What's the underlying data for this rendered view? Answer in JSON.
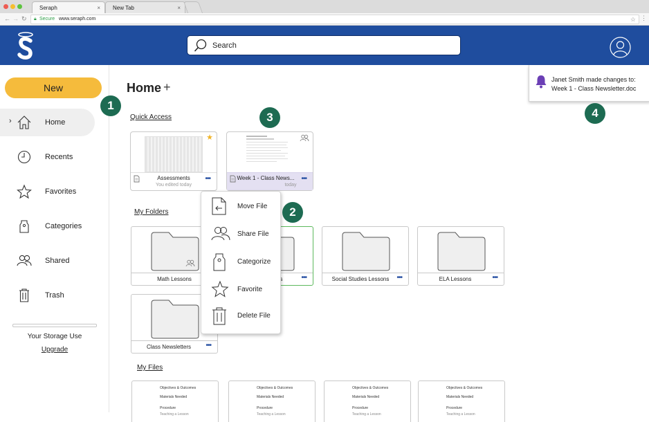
{
  "browser": {
    "tabs": [
      {
        "label": "Seraph",
        "close": "×"
      },
      {
        "label": "New Tab",
        "close": "×"
      }
    ],
    "secure_label": "Secure",
    "url": "www.seraph.com"
  },
  "header": {
    "logo_letter": "S",
    "search_placeholder": "Search"
  },
  "sidebar": {
    "new_label": "New",
    "items": [
      {
        "label": "Home",
        "icon": "home-icon",
        "active": true
      },
      {
        "label": "Recents",
        "icon": "clock-icon"
      },
      {
        "label": "Favorites",
        "icon": "star-icon"
      },
      {
        "label": "Categories",
        "icon": "tag-icon"
      },
      {
        "label": "Shared",
        "icon": "users-icon"
      },
      {
        "label": "Trash",
        "icon": "trash-icon"
      }
    ],
    "storage_label": "Your Storage Use",
    "upgrade_label": "Upgrade"
  },
  "main": {
    "title": "Home",
    "add_glyph": "+",
    "quick_access_label": "Quick Access",
    "quick_access": [
      {
        "name": "Assessments",
        "sub": "You edited today",
        "starred": true
      },
      {
        "name": "Week 1 - Class News...",
        "sub": "today",
        "shared": true,
        "selected": true
      }
    ],
    "my_folders_label": "My Folders",
    "folders": [
      {
        "name": "Math Lessons",
        "shared": true
      },
      {
        "name": "ssons"
      },
      {
        "name": "Social Studies Lessons"
      },
      {
        "name": "ELA Lessons"
      },
      {
        "name": "Class Newsletters"
      }
    ],
    "my_files_label": "My Files",
    "file_lines": [
      "Objectives & Outcomes",
      "Materials Needed",
      "Procedure",
      "Teaching a Lesson"
    ]
  },
  "context_menu": {
    "items": [
      {
        "label": "Move File",
        "icon": "move-file-icon"
      },
      {
        "label": "Share File",
        "icon": "share-users-icon"
      },
      {
        "label": "Categorize",
        "icon": "tag-icon"
      },
      {
        "label": "Favorite",
        "icon": "star-icon"
      },
      {
        "label": "Delete File",
        "icon": "trash-icon"
      }
    ]
  },
  "notification": {
    "line1": "Janet Smith made changes to:",
    "line2": "Week 1 - Class Newsletter.doc"
  },
  "callouts": [
    "1",
    "2",
    "3",
    "4"
  ],
  "colors": {
    "header": "#1f4d9e",
    "new_button": "#f5bb3c",
    "callout": "#1d6b52",
    "dots": "#2f56a6",
    "selected_card": "#e4e0f2",
    "bell": "#6b3fb5"
  }
}
